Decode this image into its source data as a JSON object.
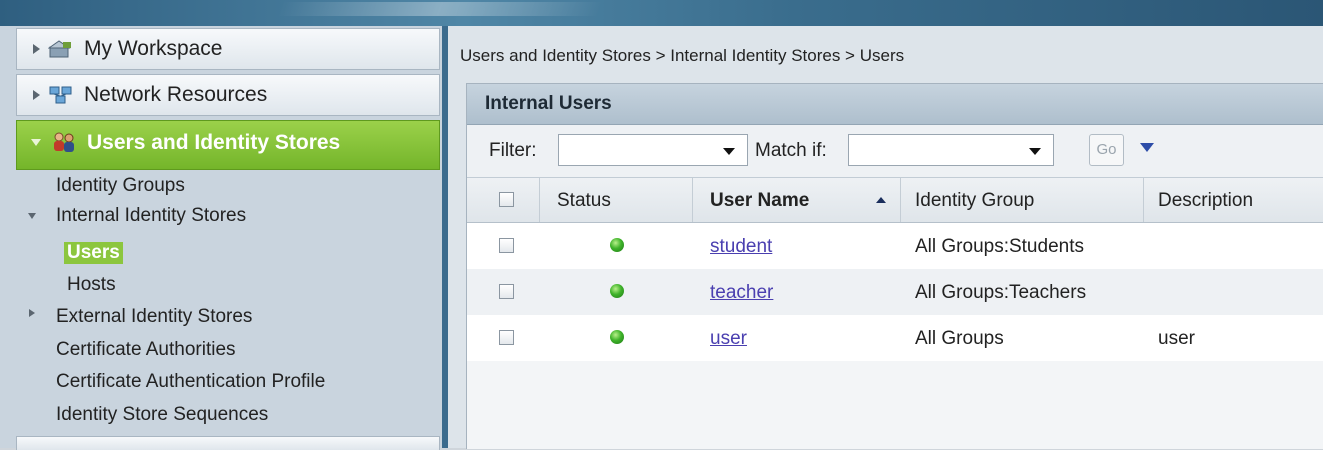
{
  "breadcrumb": "Users and Identity Stores > Internal Identity Stores > Users",
  "sidebar": {
    "drawers": [
      {
        "label": "My Workspace",
        "icon": "workspace-icon"
      },
      {
        "label": "Network Resources",
        "icon": "network-icon"
      },
      {
        "label": "Users and Identity Stores",
        "icon": "users-icon"
      }
    ],
    "items": {
      "identity_groups": "Identity Groups",
      "internal_stores": "Internal Identity Stores",
      "users": "Users",
      "hosts": "Hosts",
      "external_stores": "External Identity Stores",
      "cert_authorities": "Certificate Authorities",
      "cert_auth_profile": "Certificate Authentication Profile",
      "store_sequences": "Identity Store Sequences"
    }
  },
  "panel": {
    "title": "Internal Users",
    "filter_label": "Filter:",
    "match_label": "Match if:",
    "filter_value": "",
    "match_value": "",
    "go_label": "Go"
  },
  "table": {
    "columns": [
      "Status",
      "User Name",
      "Identity Group",
      "Description"
    ],
    "rows": [
      {
        "status": "enabled",
        "user_name": "student",
        "identity_group": "All Groups:Students",
        "description": ""
      },
      {
        "status": "enabled",
        "user_name": "teacher",
        "identity_group": "All Groups:Teachers",
        "description": ""
      },
      {
        "status": "enabled",
        "user_name": "user",
        "identity_group": "All Groups",
        "description": "user"
      }
    ]
  },
  "colors": {
    "accent_green": "#8cc63e",
    "link": "#4a3fb0",
    "status_ok": "#3fb32a"
  }
}
